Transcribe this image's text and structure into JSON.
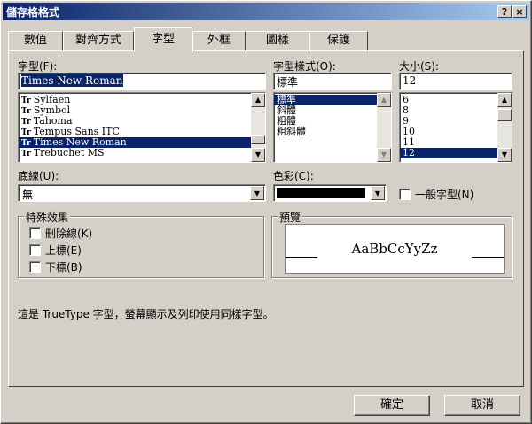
{
  "window": {
    "title": "儲存格格式",
    "help_label": "?",
    "close_label": "×"
  },
  "tabs": [
    {
      "label": "數值"
    },
    {
      "label": "對齊方式"
    },
    {
      "label": "字型"
    },
    {
      "label": "外框"
    },
    {
      "label": "圖樣"
    },
    {
      "label": "保護"
    }
  ],
  "font": {
    "label": "字型(F):",
    "value": "Times New Roman",
    "items": [
      {
        "label": "Sylfaen",
        "selected": false
      },
      {
        "label": "Symbol",
        "selected": false
      },
      {
        "label": "Tahoma",
        "selected": false
      },
      {
        "label": "Tempus Sans ITC",
        "selected": false
      },
      {
        "label": "Times New Roman",
        "selected": true
      },
      {
        "label": "Trebuchet MS",
        "selected": false
      }
    ],
    "type_glyph": "Tr"
  },
  "style": {
    "label": "字型樣式(O):",
    "value": "標準",
    "items": [
      "標準",
      "斜體",
      "粗體",
      "粗斜體"
    ]
  },
  "size": {
    "label": "大小(S):",
    "value": "12",
    "items": [
      "6",
      "8",
      "9",
      "10",
      "11",
      "12"
    ]
  },
  "underline": {
    "label": "底線(U):",
    "value": "無"
  },
  "color": {
    "label": "色彩(C):",
    "swatch": "#000000"
  },
  "normal_font": {
    "label": "一般字型(N)"
  },
  "effects": {
    "title": "特殊效果",
    "strike": "刪除線(K)",
    "superscript": "上標(E)",
    "subscript": "下標(B)"
  },
  "preview": {
    "title": "預覽",
    "sample": "AaBbCcYyZz"
  },
  "info_text": "這是 TrueType 字型，螢幕顯示及列印使用同樣字型。",
  "buttons": {
    "ok": "確定",
    "cancel": "取消"
  }
}
